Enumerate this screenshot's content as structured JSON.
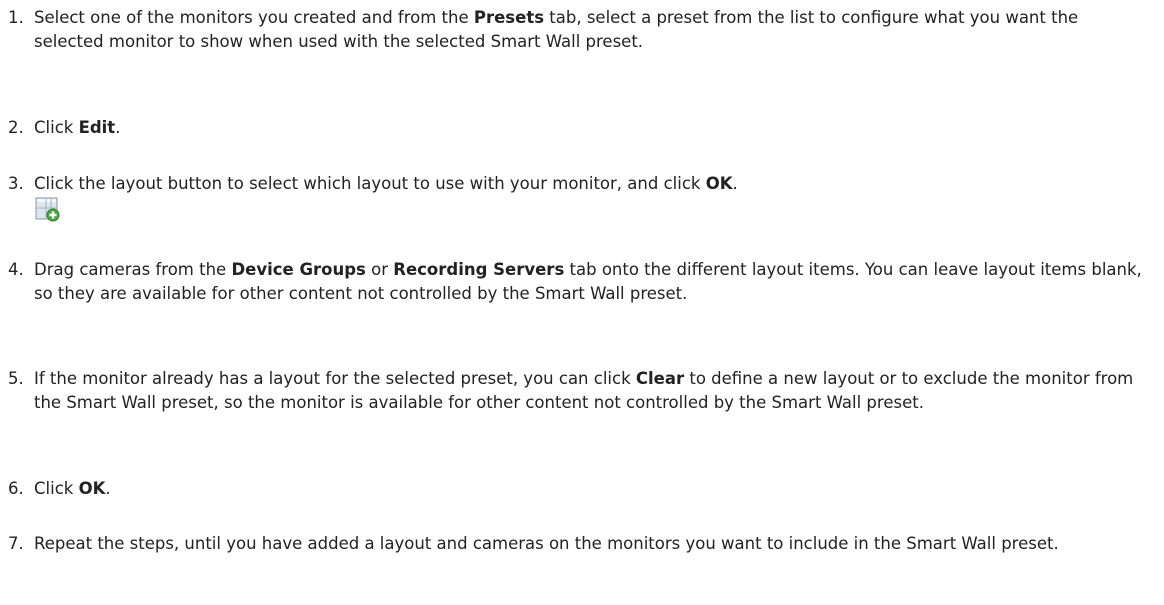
{
  "steps": [
    {
      "num": "1.",
      "segments": [
        {
          "text": "Select one of the monitors you created and from the "
        },
        {
          "text": "Presets",
          "bold": true
        },
        {
          "text": " tab, select a preset from the list to configure what you want the selected monitor to show when used with the selected Smart Wall preset."
        }
      ]
    },
    {
      "num": "2.",
      "segments": [
        {
          "text": "Click "
        },
        {
          "text": "Edit",
          "bold": true
        },
        {
          "text": "."
        }
      ]
    },
    {
      "num": "3.",
      "segments": [
        {
          "text": "Click the layout button to select which layout to use with your monitor, and click "
        },
        {
          "text": "OK",
          "bold": true
        },
        {
          "text": "."
        }
      ],
      "icon": "layout-add-icon"
    },
    {
      "num": "4.",
      "segments": [
        {
          "text": "Drag cameras from the "
        },
        {
          "text": "Device Groups",
          "bold": true
        },
        {
          "text": " or "
        },
        {
          "text": "Recording Servers",
          "bold": true
        },
        {
          "text": " tab onto the different layout items. You can leave layout items blank, so they are available for other content not controlled by the Smart Wall preset."
        }
      ]
    },
    {
      "num": "5.",
      "segments": [
        {
          "text": "If the monitor already has a layout for the selected preset, you can click "
        },
        {
          "text": "Clear",
          "bold": true
        },
        {
          "text": " to define a new layout or to exclude the monitor from the Smart Wall preset, so the monitor is available for other content not controlled by the Smart Wall preset."
        }
      ]
    },
    {
      "num": "6.",
      "segments": [
        {
          "text": "Click "
        },
        {
          "text": "OK",
          "bold": true
        },
        {
          "text": "."
        }
      ]
    },
    {
      "num": "7.",
      "segments": [
        {
          "text": "Repeat the steps, until you have added a layout and cameras on the monitors you want to include in the Smart Wall preset."
        }
      ]
    }
  ]
}
